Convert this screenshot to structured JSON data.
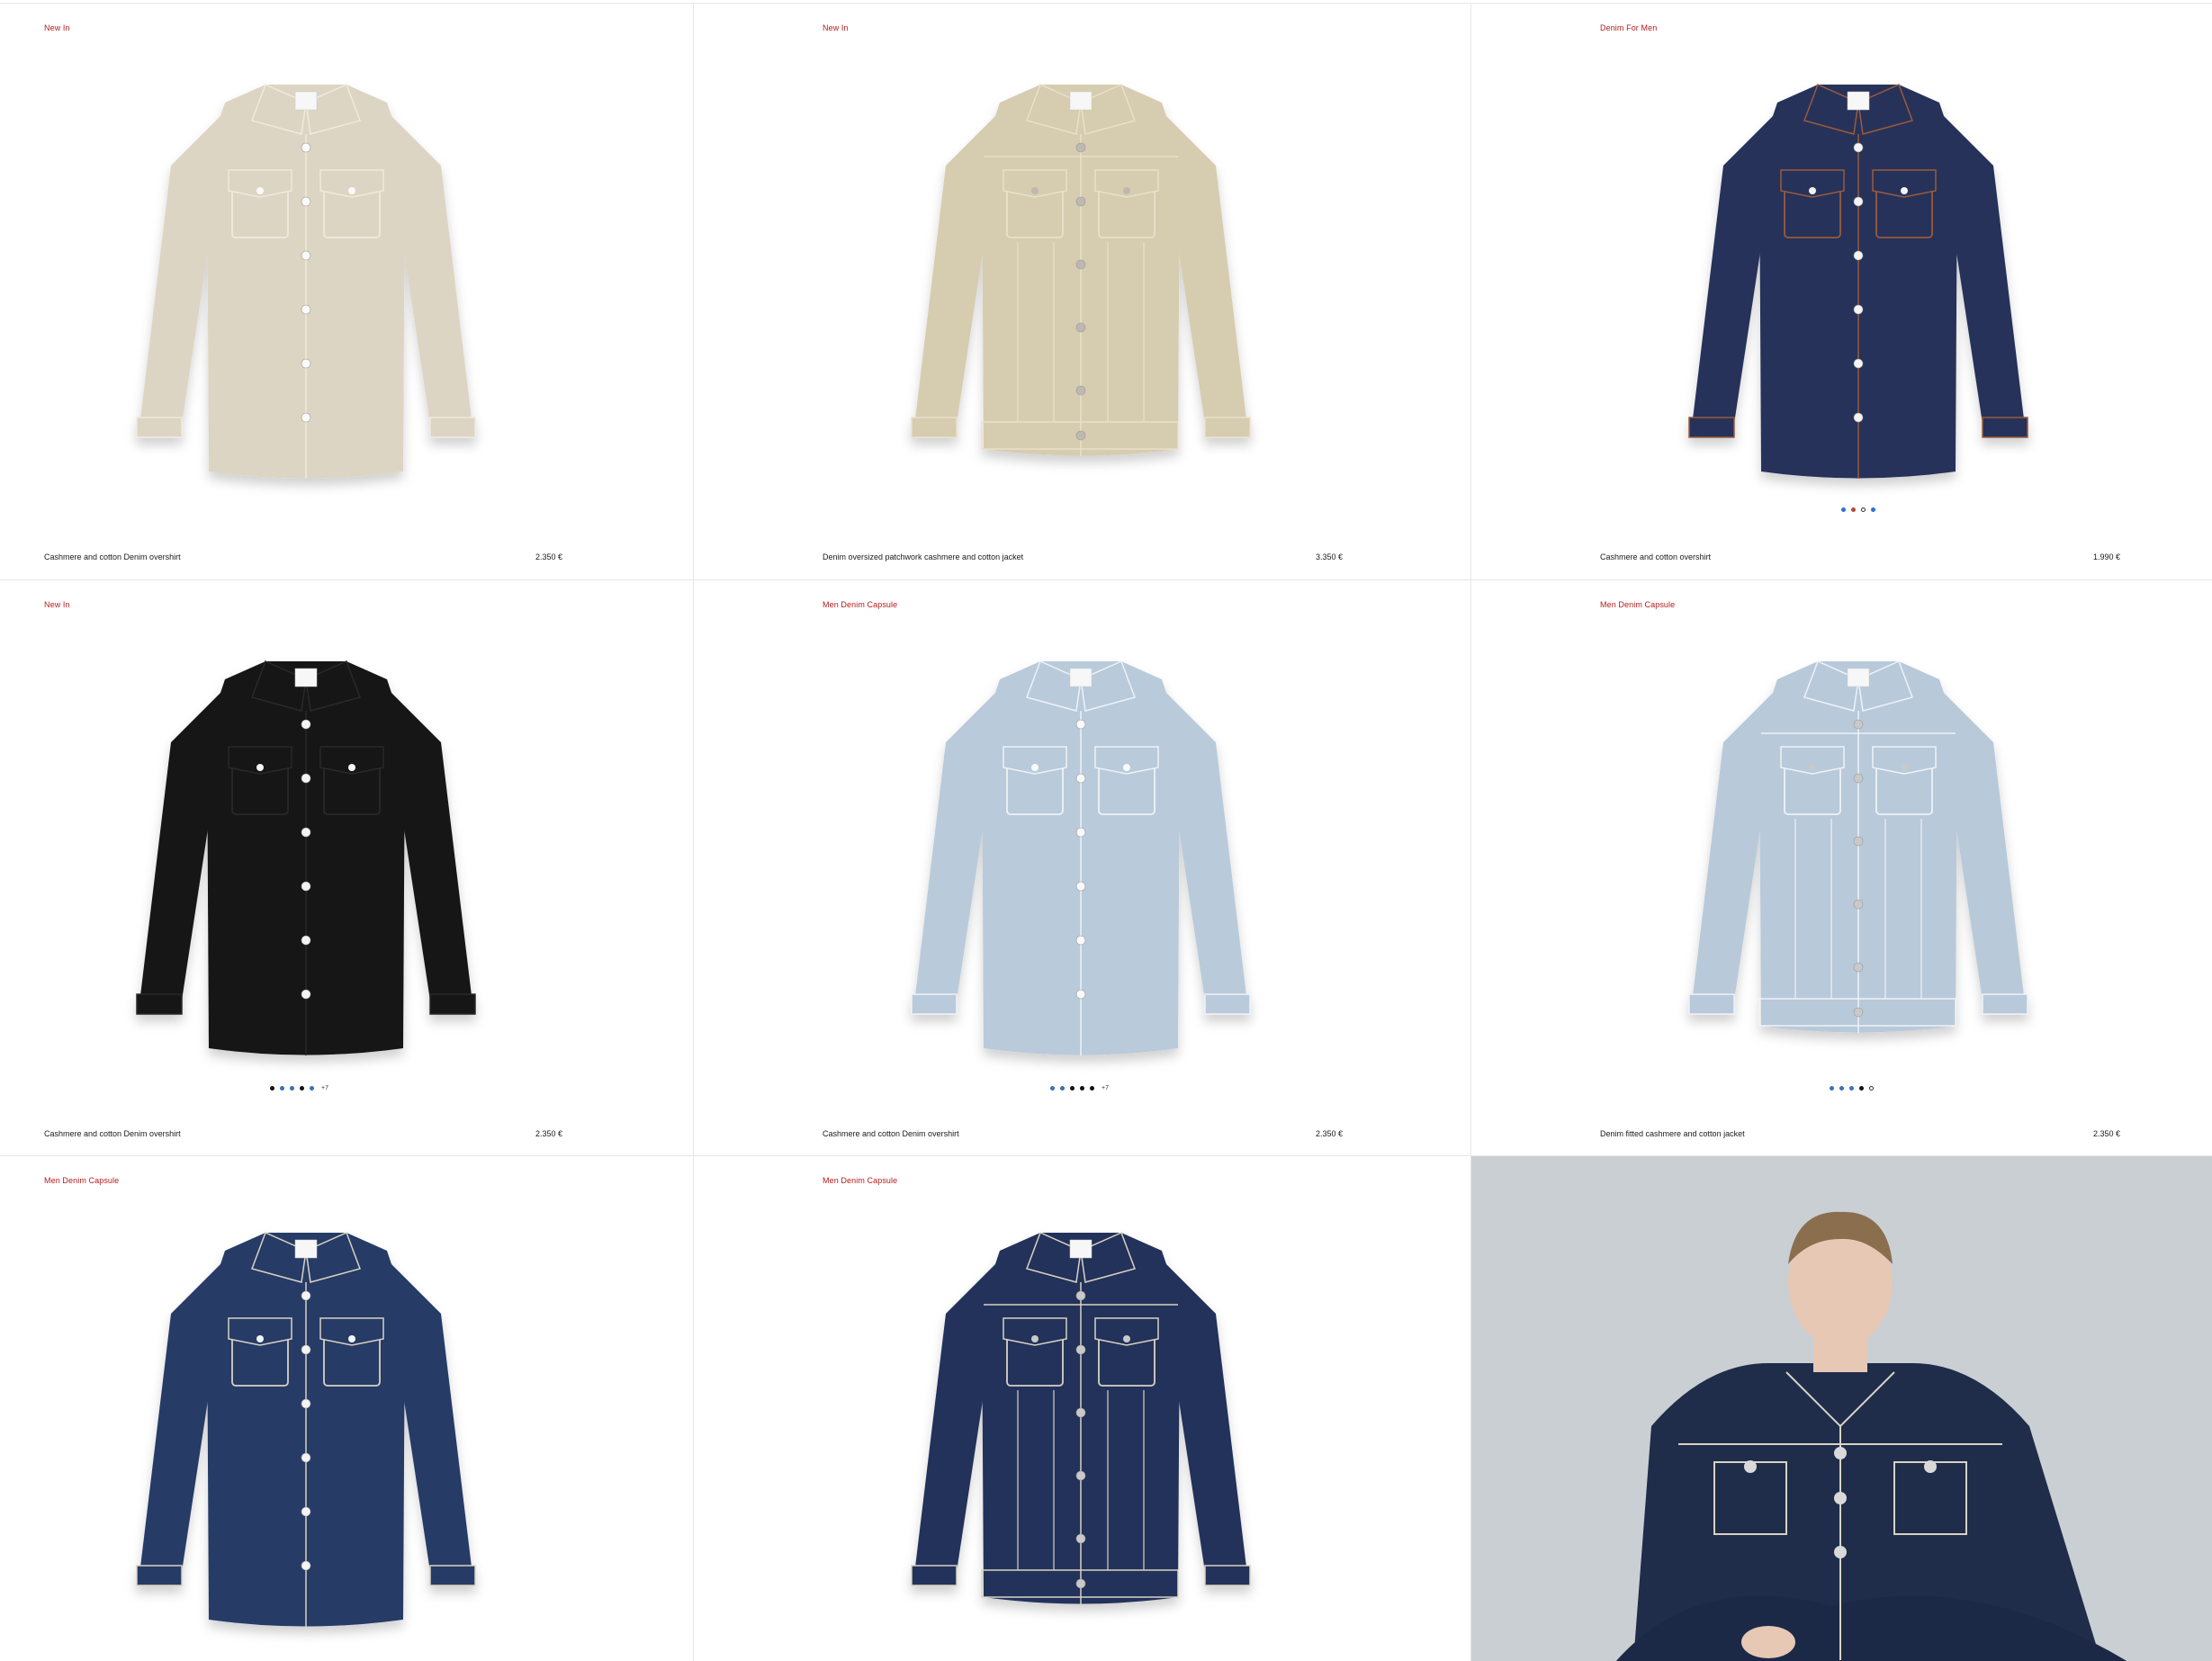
{
  "products": [
    {
      "tag": "New In",
      "name": "Cashmere and cotton Denim overshirt",
      "price": "2.350 €",
      "color": "#ddd5c3",
      "stitch": "#efeadd",
      "button": "#fafafa",
      "style": "shirt",
      "swatches": []
    },
    {
      "tag": "New In",
      "name": "Denim oversized patchwork cashmere and cotton jacket",
      "price": "3.350 €",
      "color": "#d6ccb0",
      "stitch": "#e8e0c9",
      "button": "#bdb9b0",
      "style": "jacket",
      "swatches": []
    },
    {
      "tag": "Denim For Men",
      "name": "Cashmere and cotton overshirt",
      "price": "1.990 €",
      "color": "#26335a",
      "stitch": "#9a5a3a",
      "button": "#f4f4f4",
      "style": "overshirt",
      "swatches": [
        "#2d6fd1",
        "#b04a3c",
        "hollow",
        "#2d6fd1"
      ]
    },
    {
      "tag": "New In",
      "name": "Cashmere and cotton Denim overshirt",
      "price": "2.350 €",
      "color": "#141414",
      "stitch": "#2a2a2a",
      "button": "#f4f4f4",
      "style": "shirt",
      "swatches": [
        "#111111",
        "#3b6fb6",
        "#3b6fb6",
        "#111111",
        "#3b6fb6"
      ],
      "more": "+7"
    },
    {
      "tag": "Men Denim Capsule",
      "name": "Cashmere and cotton Denim overshirt",
      "price": "2.350 €",
      "color": "#b9cadb",
      "stitch": "#eef2f6",
      "button": "#fafafa",
      "style": "shirt",
      "swatches": [
        "#3b6fb6",
        "#3b6fb6",
        "#111111",
        "#111111",
        "#111111"
      ],
      "more": "+7"
    },
    {
      "tag": "Men Denim Capsule",
      "name": "Denim fitted cashmere and cotton jacket",
      "price": "2.350 €",
      "color": "#b8c9da",
      "stitch": "#eef2f6",
      "button": "#c9c9c9",
      "style": "jacket",
      "swatches": [
        "#3b6fb6",
        "#3b6fb6",
        "#3b6fb6",
        "#111111",
        "hollow"
      ]
    },
    {
      "tag": "Men Denim Capsule",
      "name": "",
      "price": "",
      "color": "#263a66",
      "stitch": "#d8d2c2",
      "button": "#f4f4f4",
      "style": "shirt",
      "swatches": []
    },
    {
      "tag": "Men Denim Capsule",
      "name": "",
      "price": "",
      "color": "#22315a",
      "stitch": "#d8d2c2",
      "button": "#c9c9c9",
      "style": "jacket",
      "swatches": []
    }
  ],
  "editorial": {
    "jacket": "#1f2c4a",
    "stitch": "#d8d2c2",
    "skin": "#e6c8b4",
    "hair": "#8a6e4e",
    "background": "#c9cfd3"
  }
}
